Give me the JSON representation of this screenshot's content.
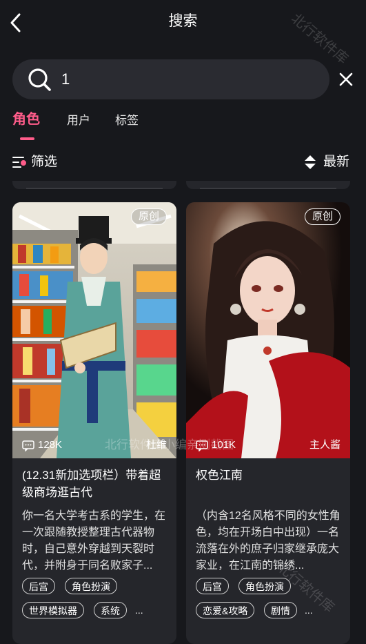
{
  "header": {
    "title": "搜索"
  },
  "search": {
    "value": "1"
  },
  "tabs": [
    {
      "label": "角色",
      "active": true
    },
    {
      "label": "用户",
      "active": false
    },
    {
      "label": "标签",
      "active": false
    }
  ],
  "toolbar": {
    "filter_label": "筛选",
    "sort_label": "最新"
  },
  "colors": {
    "accent": "#ff5c8a",
    "background": "#17181c",
    "card": "#25262b"
  },
  "cards": [
    {
      "badge": "原创",
      "chat_count": "128K",
      "author": "杜维",
      "title": "(12.31新加选项栏）带着超级商场逛古代",
      "description": "你一名大学考古系的学生，在一次跟随教授整理古代器物时，自己意外穿越到天裂时代，并附身于同名败家子...",
      "tags_row1": [
        "后宫",
        "角色扮演"
      ],
      "tags_row2": [
        "世界模拟器",
        "系统"
      ],
      "more": "..."
    },
    {
      "badge": "原创",
      "chat_count": "101K",
      "author": "主人酱",
      "title": "权色江南",
      "description": "（内含12名风格不同的女性角色，均在开场白中出现）一名流落在外的庶子归家继承庞大家业，在江南的锦绣...",
      "tags_row1": [
        "后宫",
        "角色扮演"
      ],
      "tags_row2": [
        "恋爱&攻略",
        "剧情"
      ],
      "more": "..."
    }
  ],
  "watermarks": {
    "corner": "北行软件库",
    "center": "北行软件库小编亲测截图"
  }
}
